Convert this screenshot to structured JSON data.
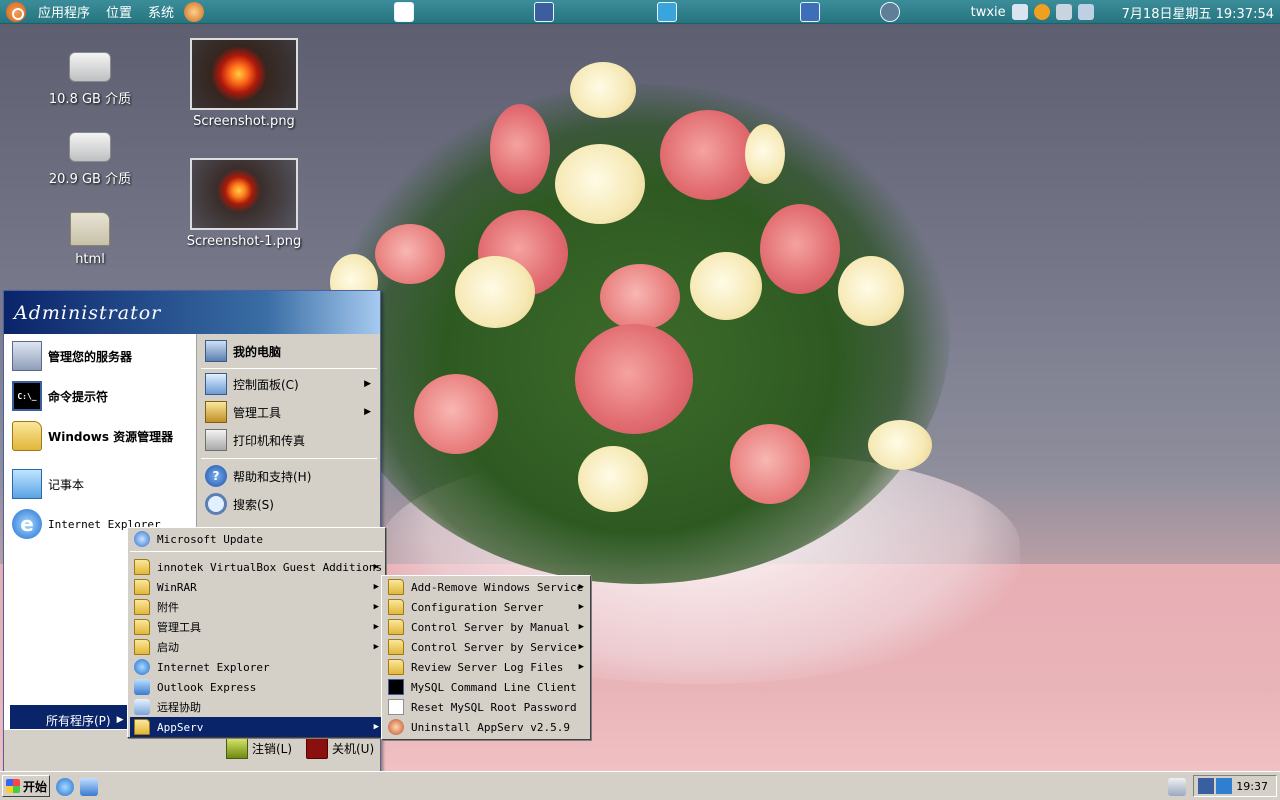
{
  "top_panel": {
    "menus": [
      "应用程序",
      "位置",
      "系统"
    ],
    "user": "twxie",
    "clock": "7月18日星期五 19:37:54"
  },
  "desktop": {
    "icons": [
      {
        "label": "10.8 GB 介质",
        "icon": "drive-icon"
      },
      {
        "label": "20.9 GB 介质",
        "icon": "drive-icon"
      },
      {
        "label": "html",
        "icon": "folder-icon"
      },
      {
        "label": "Screenshot.png",
        "icon": "image-thumbnail"
      },
      {
        "label": "Screenshot-1.png",
        "icon": "image-thumbnail"
      }
    ]
  },
  "start_menu": {
    "user": "Administrator",
    "left_pinned": [
      "管理您的服务器",
      "命令提示符",
      "Windows 资源管理器"
    ],
    "left_recent": [
      "记事本",
      "Internet Explorer"
    ],
    "right_items": [
      "我的电脑",
      "控制面板(C)",
      "管理工具",
      "打印机和传真",
      "帮助和支持(H)",
      "搜索(S)"
    ],
    "all_programs": "所有程序(P)",
    "logoff": "注销(L)",
    "shutdown": "关机(U)"
  },
  "programs_menu": {
    "items": [
      {
        "label": "Microsoft Update",
        "submenu": false
      },
      {
        "label": "innotek VirtualBox Guest Additions",
        "submenu": true
      },
      {
        "label": "WinRAR",
        "submenu": true
      },
      {
        "label": "附件",
        "submenu": true
      },
      {
        "label": "管理工具",
        "submenu": true
      },
      {
        "label": "启动",
        "submenu": true
      },
      {
        "label": "Internet Explorer",
        "submenu": false
      },
      {
        "label": "Outlook Express",
        "submenu": false
      },
      {
        "label": "远程协助",
        "submenu": false
      },
      {
        "label": "AppServ",
        "submenu": true,
        "selected": true
      }
    ]
  },
  "appserv_menu": {
    "items": [
      {
        "label": "Add-Remove Windows Service",
        "submenu": true
      },
      {
        "label": "Configuration Server",
        "submenu": true
      },
      {
        "label": "Control Server by Manual",
        "submenu": true
      },
      {
        "label": "Control Server by Service",
        "submenu": true
      },
      {
        "label": "Review Server Log Files",
        "submenu": true
      },
      {
        "label": "MySQL Command Line Client",
        "submenu": false
      },
      {
        "label": "Reset MySQL Root Password",
        "submenu": false
      },
      {
        "label": "Uninstall AppServ v2.5.9",
        "submenu": false
      }
    ]
  },
  "taskbar": {
    "start_label": "开始",
    "clock": "19:37"
  },
  "colors": {
    "panel": "#267580",
    "selection": "#0a246a",
    "menu_bg": "#d4d0c8"
  }
}
